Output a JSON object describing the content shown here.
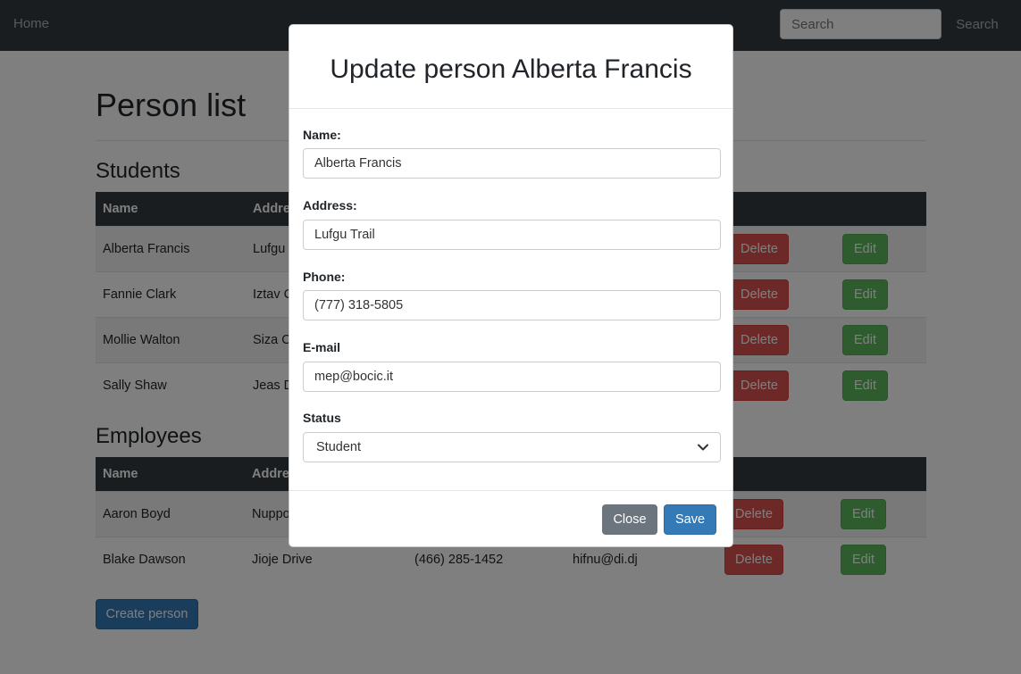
{
  "navbar": {
    "home_label": "Home",
    "search_placeholder": "Search",
    "search_button_label": "Search"
  },
  "page": {
    "title": "Person list",
    "create_button_label": "Create person"
  },
  "students": {
    "title": "Students",
    "columns": [
      "Name",
      "Address",
      "",
      "",
      "",
      ""
    ],
    "rows": [
      {
        "name": "Alberta Francis",
        "address": "Lufgu Trail",
        "delete_label": "Delete",
        "edit_label": "Edit"
      },
      {
        "name": "Fannie Clark",
        "address": "Iztav Circle",
        "delete_label": "Delete",
        "edit_label": "Edit"
      },
      {
        "name": "Mollie Walton",
        "address": "Siza Court",
        "delete_label": "Delete",
        "edit_label": "Edit"
      },
      {
        "name": "Sally Shaw",
        "address": "Jeas Drive",
        "delete_label": "Delete",
        "edit_label": "Edit"
      }
    ]
  },
  "employees": {
    "title": "Employees",
    "columns": [
      "Name",
      "Address",
      "",
      "",
      "",
      ""
    ],
    "rows": [
      {
        "name": "Aaron Boyd",
        "address": "Nuppo Road",
        "phone": "",
        "email": "",
        "delete_label": "Delete",
        "edit_label": "Edit"
      },
      {
        "name": "Blake Dawson",
        "address": "Jioje Drive",
        "phone": "(466) 285-1452",
        "email": "hifnu@di.dj",
        "delete_label": "Delete",
        "edit_label": "Edit"
      }
    ]
  },
  "modal": {
    "title": "Update person Alberta Francis",
    "name_label": "Name:",
    "name_value": "Alberta Francis",
    "address_label": "Address:",
    "address_value": "Lufgu Trail",
    "phone_label": "Phone:",
    "phone_value": "(777) 318-5805",
    "email_label": "E-mail",
    "email_value": "mep@bocic.it",
    "status_label": "Status",
    "status_value": "Student",
    "close_label": "Close",
    "save_label": "Save"
  },
  "colors": {
    "navbar_bg": "#343a40",
    "danger": "#d9534f",
    "success": "#5cb85c",
    "primary": "#337ab7",
    "secondary": "#6c757d"
  },
  "icons": {
    "status_select": "chevron-down-icon"
  }
}
